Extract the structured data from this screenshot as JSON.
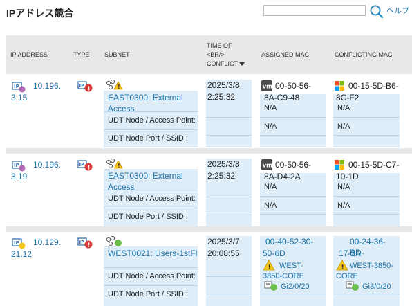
{
  "header": {
    "title": "IPアドレス競合",
    "search_placeholder": "",
    "help_label": "ヘルプ"
  },
  "columns": {
    "ip": "IP ADDRESS",
    "type": "TYPE",
    "subnet": "SUBNET",
    "time_line1": "TIME OF",
    "time_line2": "<BR/>",
    "time_line3": "CONFLICT",
    "assigned": "ASSIGNED MAC",
    "conflicting": "CONFLICTING MAC"
  },
  "rows": [
    {
      "ip_line1": "10.196.",
      "ip_line2": "3.15",
      "subnet_line1": "EAST0300: External",
      "subnet_line2": "Access",
      "udt_node_label": "UDT Node / Access Point:",
      "udt_port_label": "UDT Node Port / SSID :",
      "time_line1": "2025/3/8",
      "time_line2": "2:25:32",
      "assigned_line1": "00-50-56-",
      "assigned_line2": "8A-C9-48",
      "assigned_node": "N/A",
      "assigned_port": "N/A",
      "conflicting_line1": "00-15-5D-B6-",
      "conflicting_line2": "8C-F2",
      "conflicting_node": "N/A",
      "conflicting_port": "N/A"
    },
    {
      "ip_line1": "10.196.",
      "ip_line2": "3.19",
      "subnet_line1": "EAST0300: External",
      "subnet_line2": "Access",
      "udt_node_label": "UDT Node / Access Point:",
      "udt_port_label": "UDT Node Port / SSID :",
      "time_line1": "2025/3/8",
      "time_line2": "2:25:32",
      "assigned_line1": "00-50-56-",
      "assigned_line2": "8A-D4-2A",
      "assigned_node": "N/A",
      "assigned_port": "N/A",
      "conflicting_line1": "00-15-5D-C7-",
      "conflicting_line2": "10-1D",
      "conflicting_node": "N/A",
      "conflicting_port": "N/A"
    },
    {
      "ip_line1": "10.129.",
      "ip_line2": "21.12",
      "subnet_line1": "WEST0021: Users-1stFl",
      "udt_node_label": "UDT Node / Access Point:",
      "udt_port_label": "UDT Node Port / SSID :",
      "time_line1": "2025/3/7",
      "time_line2": "20:08:55",
      "assigned_line1": "00-40-52-30-",
      "assigned_line2": "50-6D",
      "assigned_node1": "WEST-",
      "assigned_node2": "3850-CORE",
      "assigned_port": "Gi2/0/20",
      "conflicting_line1": "00-24-36-BD-",
      "conflicting_line2": "17-2A",
      "conflicting_node1": "WEST-3850-",
      "conflicting_node2": "CORE",
      "conflicting_port": "Gi3/0/20"
    }
  ],
  "colors": {
    "link": "#1a72a8",
    "header_bg": "#e8e8e8",
    "cell_bg": "#deedf8",
    "status_purple": "#b06ab3",
    "status_yellow": "#f5c518",
    "status_green": "#6abf4b",
    "alert_red": "#d93b3b"
  }
}
